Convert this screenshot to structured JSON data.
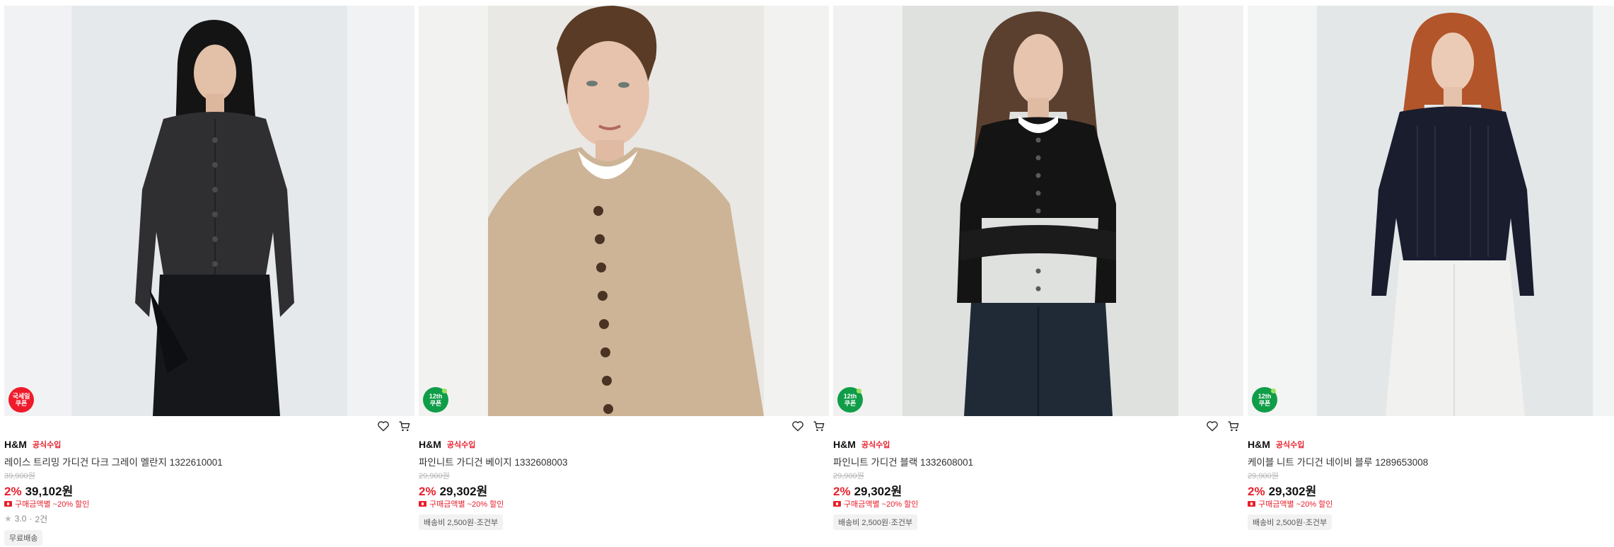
{
  "products": [
    {
      "brand": "H&M",
      "official_label": "공식수입",
      "name": "레이스 트리밍 가디건 다크 그레이 멜란지 1322610001",
      "original_price": "39,900원",
      "discount": "2%",
      "price": "39,102원",
      "coupon": "구매금액별 ~20% 할인",
      "badge": {
        "line1": "국세일",
        "line2": "쿠폰",
        "color": "#ef1b2a"
      },
      "rating": "3.0",
      "review_count": "2건",
      "chip": "무료배송",
      "image": {
        "bg": "#f1f2f4",
        "model": "long dark hair, dark grey lace-trim cardigan",
        "garment": "#2f2f31",
        "hair": "#141414",
        "bottom": "#16171b"
      }
    },
    {
      "brand": "H&M",
      "official_label": "공식수입",
      "name": "파인니트 가디건 베이지 1332608003",
      "original_price": "29,900원",
      "discount": "2%",
      "price": "29,302원",
      "coupon": "구매금액별 ~20% 할인",
      "badge": {
        "line1": "12th",
        "line2": "쿠폰",
        "color": "#0f9d48"
      },
      "chip": "배송비 2,500원·조건부",
      "image": {
        "bg": "#f2f2f0",
        "model": "short brown hair, beige fine-knit cardigan close-up",
        "garment": "#cdb497",
        "hair": "#5a3b26"
      }
    },
    {
      "brand": "H&M",
      "official_label": "공식수입",
      "name": "파인니트 가디건 블랙 1332608001",
      "original_price": "29,900원",
      "discount": "2%",
      "price": "29,302원",
      "coupon": "구매금액별 ~20% 할인",
      "badge": {
        "line1": "12th",
        "line2": "쿠폰",
        "color": "#0f9d48"
      },
      "chip": "배송비 2,500원·조건부",
      "image": {
        "bg": "#e9ebea",
        "model": "long brown hair, black fine-knit cardigan, dark jeans",
        "garment": "#141414",
        "hair": "#5b4030",
        "bottom": "#1f2a36"
      }
    },
    {
      "brand": "H&M",
      "official_label": "공식수입",
      "name": "케이블 니트 가디건 네이비 블루 1289653008",
      "original_price": "29,900원",
      "discount": "2%",
      "price": "29,302원",
      "coupon": "구매금액별 ~20% 할인",
      "badge": {
        "line1": "12th",
        "line2": "쿠폰",
        "color": "#0f9d48"
      },
      "chip": "배송비 2,500원·조건부",
      "image": {
        "bg": "#eceeee",
        "model": "long red hair, navy cable-knit cardigan, white jeans",
        "garment": "#1a1d2e",
        "hair": "#b2552a",
        "bottom": "#f1f1ef"
      }
    }
  ],
  "icons": {
    "wishlist": "heart-icon",
    "cart": "cart-icon",
    "coupon": "coupon-icon",
    "rating": "star-icon"
  },
  "colors": {
    "accent_red": "#e8202c",
    "badge_green": "#0f9d48"
  }
}
